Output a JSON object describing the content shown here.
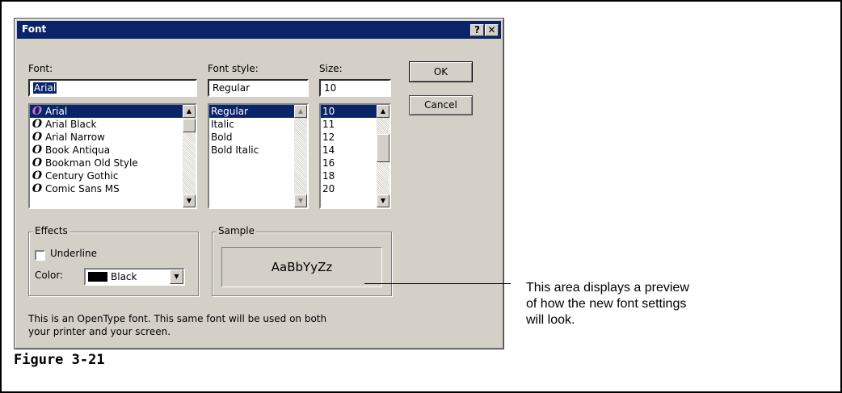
{
  "dialog": {
    "title": "Font",
    "help_button": "?",
    "close_button": "✕"
  },
  "font": {
    "label": "Font:",
    "value": "Arial",
    "items": [
      "Arial",
      "Arial Black",
      "Arial Narrow",
      "Book Antiqua",
      "Bookman Old Style",
      "Century Gothic",
      "Comic Sans MS"
    ],
    "selected": "Arial"
  },
  "style": {
    "label": "Font style:",
    "value": "Regular",
    "items": [
      "Regular",
      "Italic",
      "Bold",
      "Bold Italic"
    ],
    "selected": "Regular"
  },
  "size": {
    "label": "Size:",
    "value": "10",
    "items": [
      "10",
      "11",
      "12",
      "14",
      "16",
      "18",
      "20"
    ],
    "selected": "10"
  },
  "buttons": {
    "ok": "OK",
    "cancel": "Cancel"
  },
  "effects": {
    "title": "Effects",
    "underline_label": "Underline",
    "underline_checked": false,
    "color_label": "Color:",
    "color_value": "Black",
    "color_hex": "#000000"
  },
  "sample": {
    "title": "Sample",
    "text": "AaBbYyZz"
  },
  "description": {
    "line1": "This is an OpenType font. This same font will be used on both",
    "line2": "your printer and your screen."
  },
  "callout": {
    "line1": "This area displays a preview",
    "line2": "of how the new font settings",
    "line3": "will look."
  },
  "caption": "Figure 3-21",
  "colors": {
    "titlebar": "#0a246a",
    "dialog_bg": "#d4d0c8",
    "selection": "#0a246a"
  }
}
